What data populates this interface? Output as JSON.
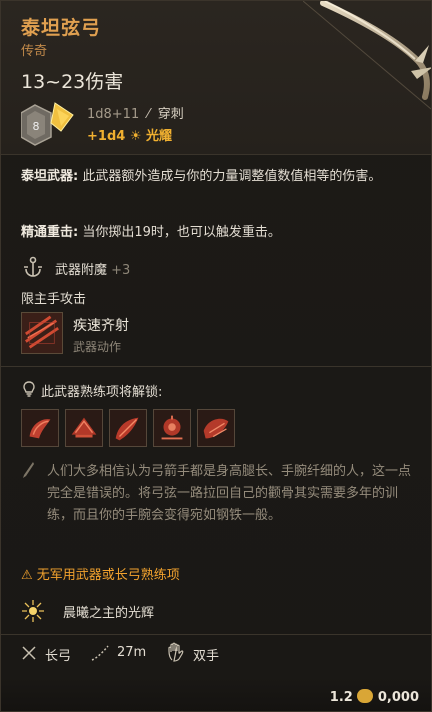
{
  "item": {
    "name": "泰坦弦弓",
    "rarity": "传奇",
    "damage_total": "13~23伤害",
    "die_value": "8",
    "damage_base": "1d8+11",
    "damage_type": "穿刺",
    "damage_bonus": "+1d4 ☀ 光耀"
  },
  "abilities": {
    "titan_weapon": {
      "name": "泰坦武器:",
      "text": "此武器额外造成与你的力量调整值数值相等的伤害。"
    },
    "proficient_crit": {
      "name": "精通重击:",
      "text": "当你掷出19时，也可以触发重击。"
    }
  },
  "enchant": {
    "label": "武器附魔",
    "value": "+3"
  },
  "main_hand_only": "限主手攻击",
  "action": {
    "name": "疾速齐射",
    "type": "武器动作"
  },
  "proficiency_unlock": "此武器熟练项将解锁:",
  "flavor": "人们大多相信认为弓箭手都是身高腿长、手腕纤细的人，这一点完全是错误的。将弓弦一路拉回自己的颧骨其实需要多年的训练，而且你的手腕会变得宛如钢铁一般。",
  "warning": "无军用武器或长弓熟练项",
  "passive": "晨曦之主的光辉",
  "footer": {
    "weapon_type": "长弓",
    "range": "27m",
    "handedness": "双手"
  },
  "price": "1.2",
  "price_rest": "0,000"
}
